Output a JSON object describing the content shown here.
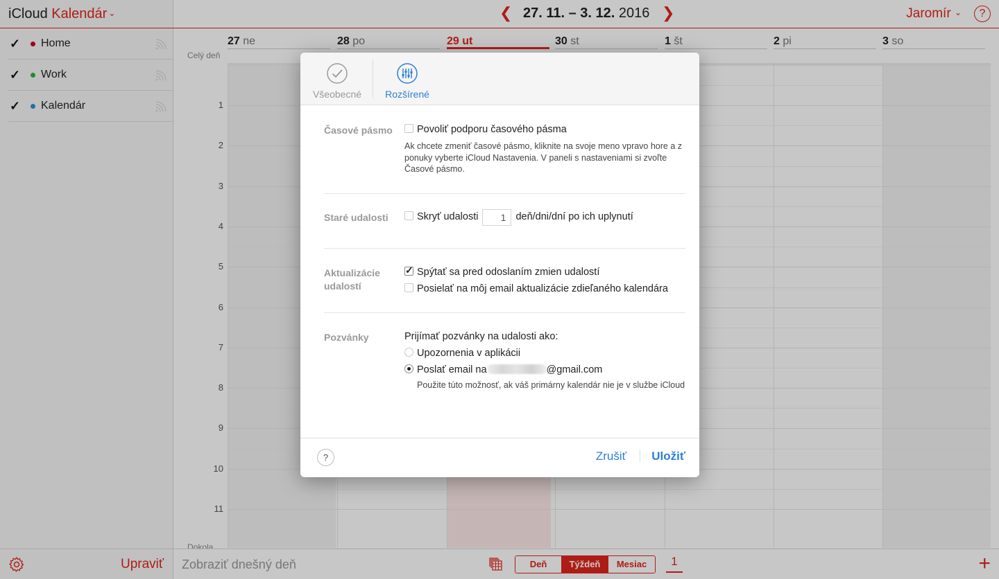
{
  "app": {
    "brand_prefix": "iCloud",
    "brand_name": "Kalendár",
    "accent": "#e0251b",
    "link_color": "#2a7fd4"
  },
  "sidebar": {
    "calendars": [
      {
        "label": "Home",
        "color": "#d0021b",
        "checked": true
      },
      {
        "label": "Work",
        "color": "#29b43e",
        "checked": true
      },
      {
        "label": "Kalendár",
        "color": "#2d8fd8",
        "checked": true
      }
    ],
    "edit_label": "Upraviť",
    "settings_icon": "gear-icon"
  },
  "header": {
    "range_text": "27. 11. – 3. 12.",
    "range_year": "2016",
    "user": "Jaromír",
    "help": "?"
  },
  "week": {
    "days": [
      {
        "num": "27",
        "name": "ne",
        "today": false
      },
      {
        "num": "28",
        "name": "po",
        "today": false
      },
      {
        "num": "29",
        "name": "ut",
        "today": true
      },
      {
        "num": "30",
        "name": "st",
        "today": false
      },
      {
        "num": "1",
        "name": "št",
        "today": false
      },
      {
        "num": "2",
        "name": "pi",
        "today": false
      },
      {
        "num": "3",
        "name": "so",
        "today": false
      }
    ],
    "all_day_label": "Celý deň",
    "hours": [
      "1",
      "2",
      "3",
      "4",
      "5",
      "6",
      "7",
      "8",
      "9",
      "10",
      "11"
    ],
    "bottom_label": "Dokola..."
  },
  "footer": {
    "today_label": "Zobraziť dnešný deň",
    "views": [
      "Deň",
      "Týždeň",
      "Mesiac"
    ],
    "active_view": "Týždeň",
    "inbox_count": "1",
    "add_label": "+"
  },
  "modal": {
    "tabs": {
      "general": "Všeobecné",
      "advanced": "Rozšírené",
      "active": "advanced"
    },
    "timezone": {
      "label": "Časové pásmo",
      "checkbox_label": "Povoliť podporu časového pásma",
      "checked": false,
      "hint": "Ak chcete zmeniť časové pásmo, kliknite na svoje meno vpravo hore a z ponuky vyberte iCloud Nastavenia. V paneli s nastaveniami si zvoľte Časové pásmo."
    },
    "old_events": {
      "label": "Staré udalosti",
      "checkbox_label": "Skryť udalosti",
      "days_value": "1",
      "suffix": "deň/dni/dní po ich uplynutí",
      "checked": false
    },
    "updates": {
      "label": "Aktualizácie udalostí",
      "option1": "Spýtať sa pred odoslaním zmien udalostí",
      "option1_checked": true,
      "option2": "Posielať na môj email aktualizácie zdieľaného kalendára",
      "option2_checked": false
    },
    "invitations": {
      "label": "Pozvánky",
      "intro": "Prijímať pozvánky na udalosti ako:",
      "option_app": "Upozornenia v aplikácii",
      "option_email_prefix": "Poslať email na",
      "option_email_domain": "@gmail.com",
      "selected": "email",
      "email_hint": "Použite túto možnosť, ak váš primárny kalendár nie je v službe iCloud"
    },
    "buttons": {
      "help": "?",
      "cancel": "Zrušiť",
      "save": "Uložiť"
    }
  }
}
